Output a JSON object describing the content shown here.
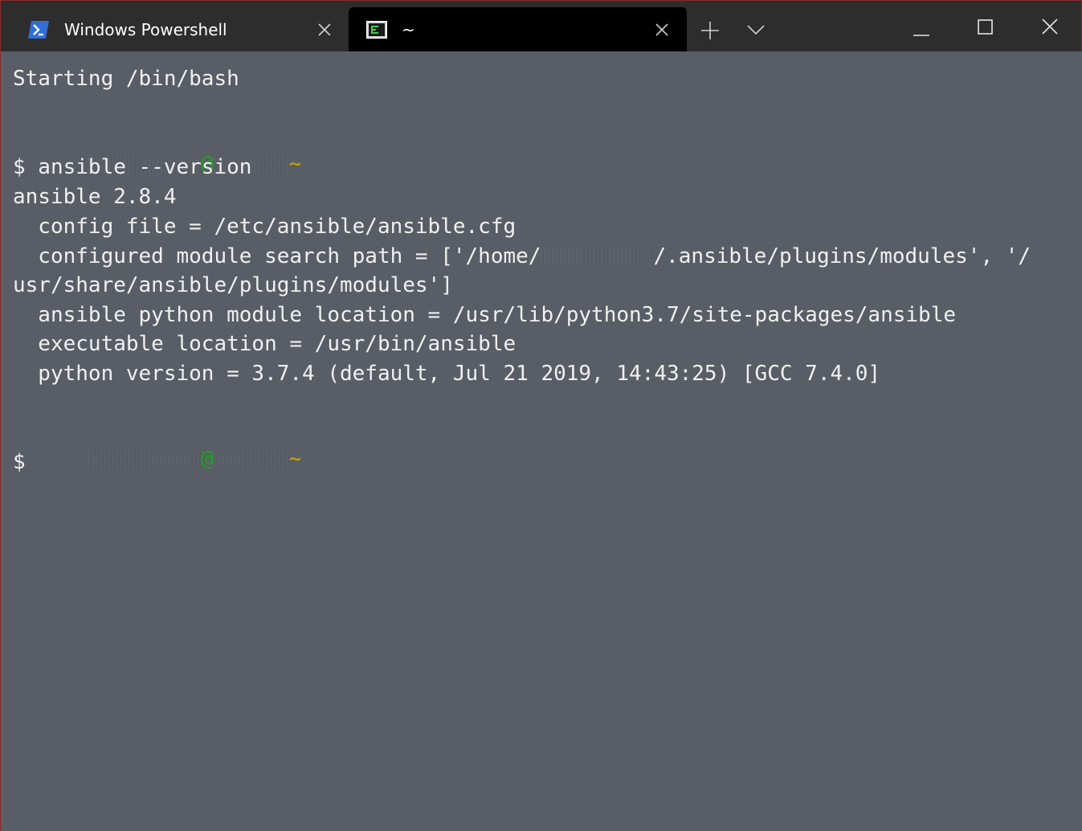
{
  "tabs": [
    {
      "title": "Windows Powershell",
      "icon": "powershell-icon",
      "active": false
    },
    {
      "title": "~",
      "icon": "terminal-icon",
      "active": true
    }
  ],
  "titlebar": {
    "new_tab_icon": "plus-icon",
    "dropdown_icon": "chevron-down-icon",
    "minimize_icon": "minimize-icon",
    "maximize_icon": "maximize-icon",
    "close_icon": "close-icon"
  },
  "colors": {
    "terminal_bg": "#595e66",
    "titlebar_bg": "#2d2d2d",
    "active_tab_bg": "#000000",
    "prompt_at": "#1fa31f",
    "prompt_path": "#c9a200"
  },
  "terminal": {
    "starting": "Starting /bin/bash",
    "prompt1": {
      "at": "@",
      "path": "~"
    },
    "cmd_line": "$ ansible --version",
    "out_version": "ansible 2.8.4",
    "out_config": "  config file = /etc/ansible/ansible.cfg",
    "out_module_path_a": "  configured module search path = ['/home/",
    "out_module_path_b": "/.ansible/plugins/modules', '/",
    "out_module_path_c": "usr/share/ansible/plugins/modules']",
    "out_python_module": "  ansible python module location = /usr/lib/python3.7/site-packages/ansible",
    "out_executable": "  executable location = /usr/bin/ansible",
    "out_python_version": "  python version = 3.7.4 (default, Jul 21 2019, 14:43:25) [GCC 7.4.0]",
    "prompt2": {
      "at": "@",
      "path": "~"
    },
    "cursor_line": "$"
  }
}
